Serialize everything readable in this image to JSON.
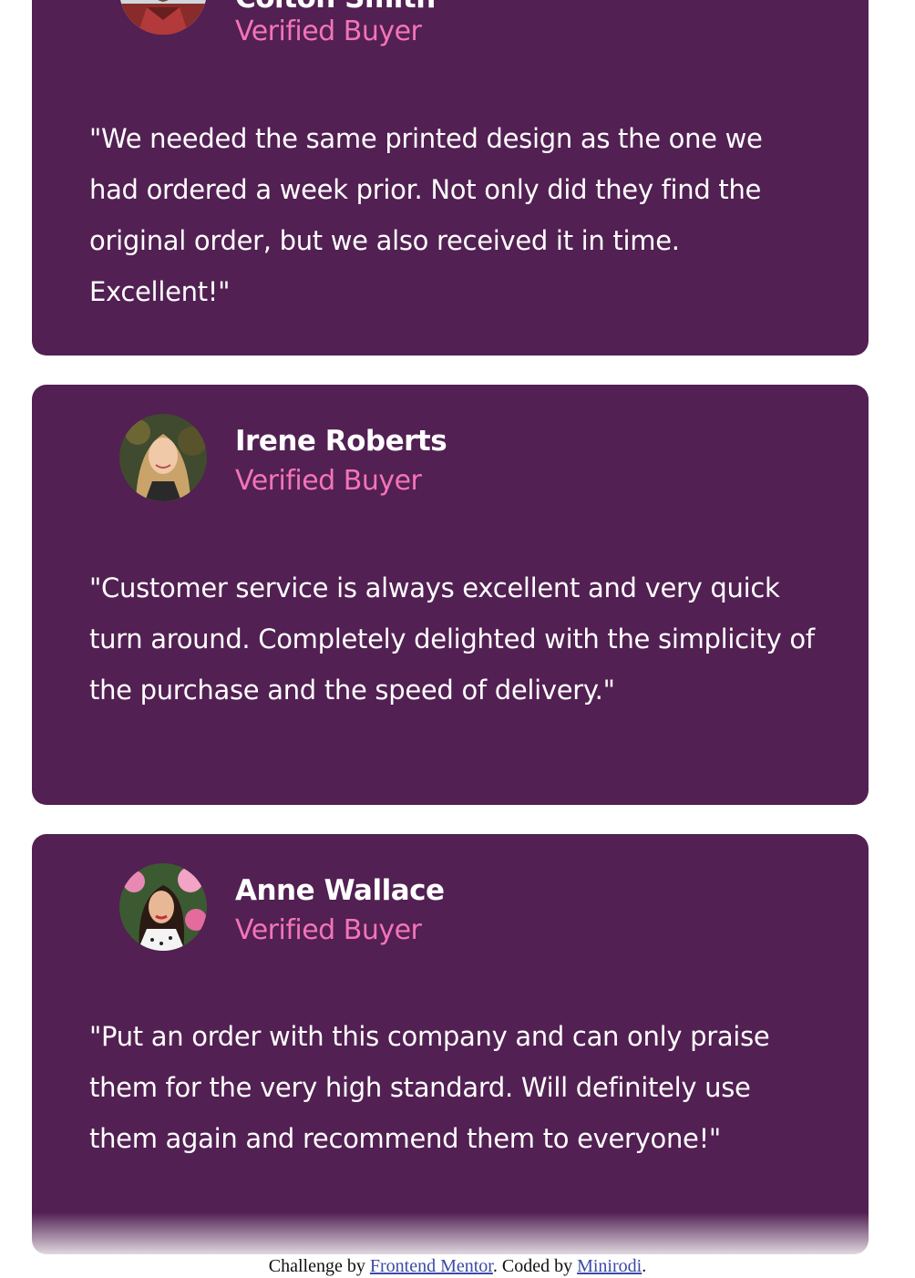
{
  "testimonials": [
    {
      "name": "Colton Smith",
      "role": "Verified Buyer",
      "quote": "\"We needed the same printed design as the one we had ordered a week prior. Not only did they find the original order, but we also received it in time. Excellent!\""
    },
    {
      "name": "Irene Roberts",
      "role": "Verified Buyer",
      "quote": "\"Customer service is always excellent and very quick turn around. Completely delighted with the simplicity of the purchase and the speed of delivery.\""
    },
    {
      "name": "Anne Wallace",
      "role": "Verified Buyer",
      "quote": "\"Put an order with this company and can only praise them for the very high standard. Will definitely use them again and recommend them to everyone!\""
    }
  ],
  "attribution": {
    "prefix": "Challenge by ",
    "link1": "Frontend Mentor",
    "middle": ". Coded by ",
    "link2": "Minirodi",
    "suffix": "."
  },
  "colors": {
    "card_bg": "#522052",
    "accent_pink": "#f374b8",
    "text_white": "#ffffff",
    "link_blue": "#3b4aa6"
  }
}
